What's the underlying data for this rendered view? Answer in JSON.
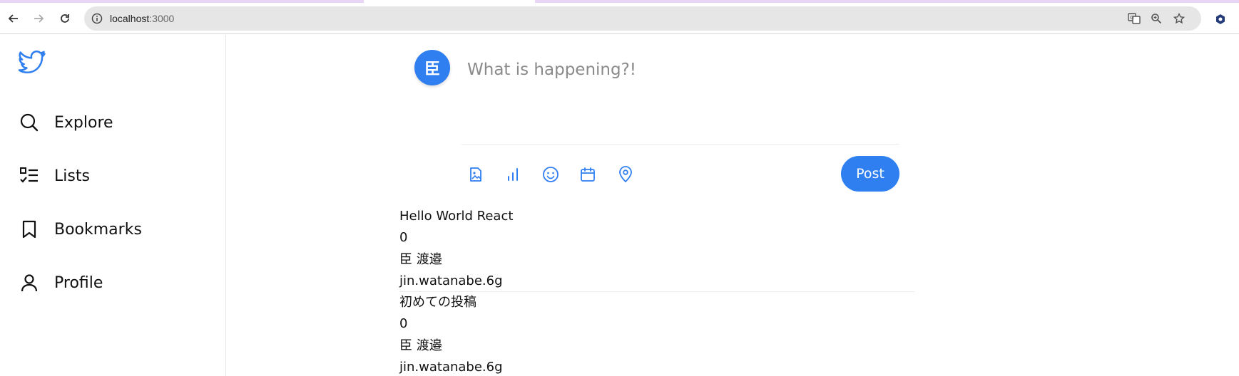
{
  "browser": {
    "url_host": "localhost",
    "url_port": ":3000",
    "icons": [
      "back-icon",
      "forward-icon",
      "reload-icon",
      "site-info-icon",
      "translate-icon",
      "zoom-icon",
      "bookmark-star-icon",
      "extension-icon"
    ]
  },
  "sidebar": {
    "logo": "twitter-bird-icon",
    "items": [
      {
        "label": "Explore",
        "icon": "search-icon"
      },
      {
        "label": "Lists",
        "icon": "list-icon"
      },
      {
        "label": "Bookmarks",
        "icon": "bookmark-icon"
      },
      {
        "label": "Profile",
        "icon": "user-icon"
      }
    ]
  },
  "composer": {
    "avatar_text": "臣",
    "placeholder": "What is happening?!",
    "tools": [
      "image-icon",
      "poll-icon",
      "emoji-icon",
      "schedule-icon",
      "location-icon"
    ],
    "post_label": "Post",
    "accent_color": "#2f7ff0"
  },
  "feed": {
    "posts": [
      {
        "content": "Hello World React",
        "likes": "0",
        "name": "臣 渡邉",
        "username": "jin.watanabe.6g"
      },
      {
        "content": "初めての投稿",
        "likes": "0",
        "name": "臣 渡邉",
        "username": "jin.watanabe.6g"
      }
    ]
  }
}
